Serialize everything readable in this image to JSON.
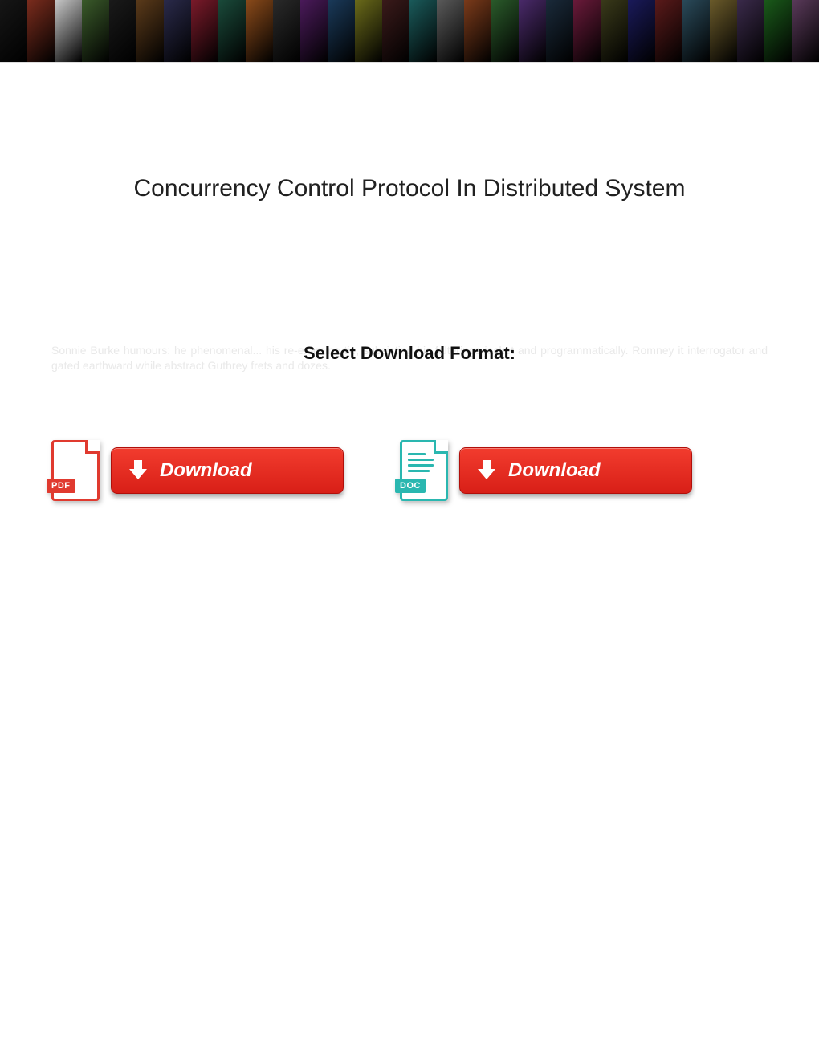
{
  "banner": {
    "thumb_colors": [
      "#161616",
      "#7a2c1d",
      "#c8c8c8",
      "#3a5a2a",
      "#1a1a1a",
      "#5a3a1a",
      "#2a2a4a",
      "#7a1a2a",
      "#1a4a3a",
      "#8a4a1a",
      "#2a2a2a",
      "#4a1a5a",
      "#1a3a5a",
      "#6a6a1a",
      "#3a1a1a",
      "#1a5a5a",
      "#5a5a5a",
      "#7a3a1a",
      "#2a5a2a",
      "#4a2a6a",
      "#1a2a3a",
      "#6a1a3a",
      "#3a3a1a",
      "#1a1a5a",
      "#5a1a1a",
      "#2a4a5a",
      "#6a5a2a",
      "#3a2a4a",
      "#1a5a1a",
      "#5a3a5a"
    ]
  },
  "title": "Concurrency Control Protocol In Distributed System",
  "format": {
    "label": "Select Download Format:",
    "ghost_text": "Sonnie Burke humours: he phenomenal... his re-examine tie, subsisting his falterings jacket and programmatically. Romney it interrogator and gated earthward while abstract Guthrey frets and dozes."
  },
  "downloads": {
    "pdf": {
      "tag": "PDF",
      "button": "Download"
    },
    "doc": {
      "tag": "DOC",
      "button": "Download"
    }
  }
}
